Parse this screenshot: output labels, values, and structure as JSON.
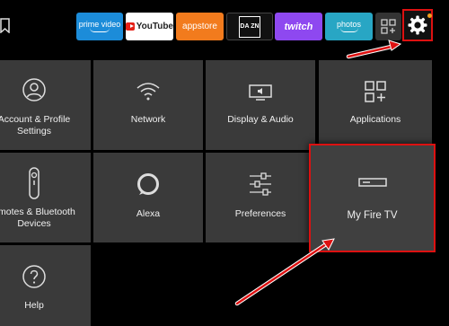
{
  "topbar": {
    "apps": [
      {
        "id": "prime",
        "label": "prime video"
      },
      {
        "id": "youtube",
        "label": "YouTube"
      },
      {
        "id": "appstore",
        "label": "appstore"
      },
      {
        "id": "dazn",
        "label": "DA ZN"
      },
      {
        "id": "twitch",
        "label": "twitch"
      },
      {
        "id": "photos",
        "label": "photos"
      }
    ]
  },
  "settings": {
    "tiles": [
      {
        "label": "Account & Profile\nSettings",
        "icon": "user-icon"
      },
      {
        "label": "Network",
        "icon": "wifi-icon"
      },
      {
        "label": "Display & Audio",
        "icon": "display-icon"
      },
      {
        "label": "Applications",
        "icon": "apps-icon"
      },
      {
        "label": "emotes & Bluetooth\nDevices",
        "icon": "remote-icon"
      },
      {
        "label": "Alexa",
        "icon": "alexa-icon"
      },
      {
        "label": "Preferences",
        "icon": "sliders-icon"
      },
      {
        "label": "My Fire TV",
        "icon": "firetv-icon"
      },
      {
        "label": "Help",
        "icon": "help-icon"
      }
    ]
  },
  "colors": {
    "highlight": "#dd1111",
    "tile": "#3a3a3a",
    "background": "#000000"
  }
}
